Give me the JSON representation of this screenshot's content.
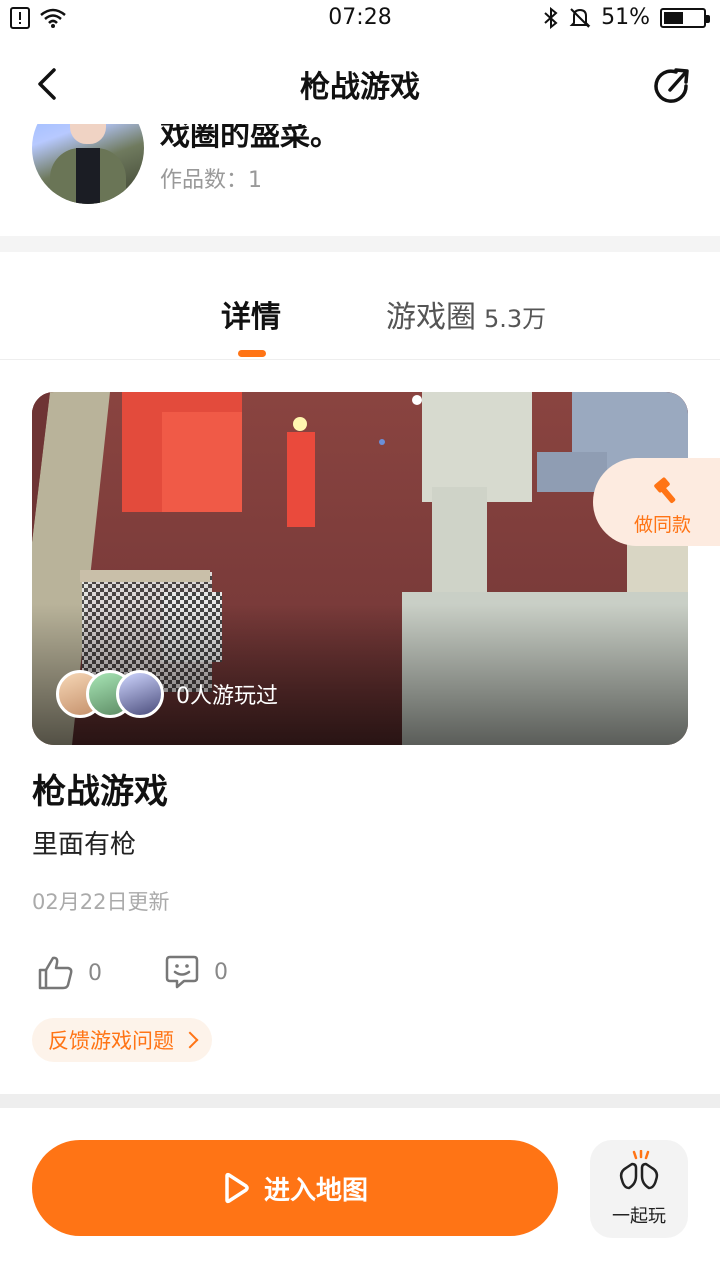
{
  "status_bar": {
    "time": "07:28",
    "battery": "51%",
    "battery_level": 0.51
  },
  "nav": {
    "title": "枪战游戏"
  },
  "author": {
    "name_partial": "戏圈的盛菜。",
    "works_count": "作品数：1"
  },
  "tabs": [
    {
      "label": "详情",
      "count": "",
      "active": true
    },
    {
      "label": "游戏圈",
      "count": "5.3万",
      "active": false
    }
  ],
  "cover": {
    "played_text": "0人游玩过"
  },
  "make_same": {
    "label": "做同款"
  },
  "game": {
    "title": "枪战游戏",
    "description": "里面有枪",
    "updated": "02月22日更新",
    "likes": "0",
    "comments": "0"
  },
  "feedback": {
    "label": "反馈游戏问题"
  },
  "bottom": {
    "enter_label": "进入地图",
    "together_label": "一起玩"
  },
  "colors": {
    "accent": "#ff7415",
    "accent_light": "#fdebe0"
  },
  "icons": [
    "back-icon",
    "share-icon",
    "like-icon",
    "comment-icon",
    "hammer-icon",
    "play-icon",
    "clap-icon",
    "wifi-icon",
    "bluetooth-icon",
    "mute-icon"
  ]
}
